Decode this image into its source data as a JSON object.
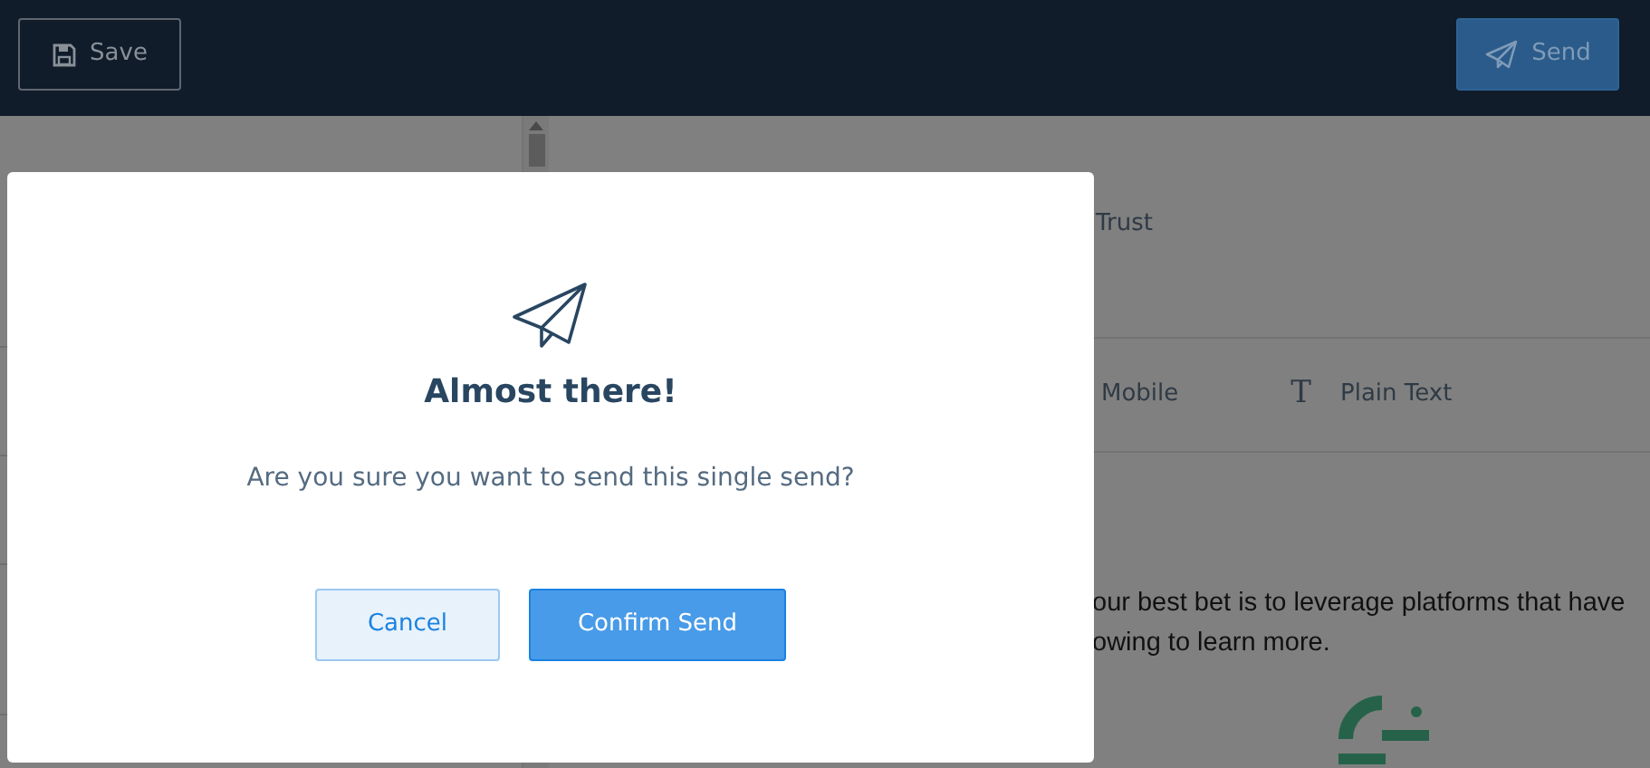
{
  "toolbar": {
    "save_button": "Save",
    "send_button": "Send"
  },
  "editor": {
    "sender_fragment": "Trust",
    "view_tabs": [
      {
        "label": "Mobile"
      },
      {
        "label": "Plain Text",
        "glyph": "T"
      }
    ],
    "body_lines": [
      "our best bet is to leverage platforms that have",
      "owing to learn more."
    ]
  },
  "dialog": {
    "title": "Almost there!",
    "message": "Are you sure you want to send this single send?",
    "buttons": [
      {
        "label": "Cancel",
        "kind": "secondary"
      },
      {
        "label": "Confirm Send",
        "kind": "primary"
      }
    ]
  }
}
